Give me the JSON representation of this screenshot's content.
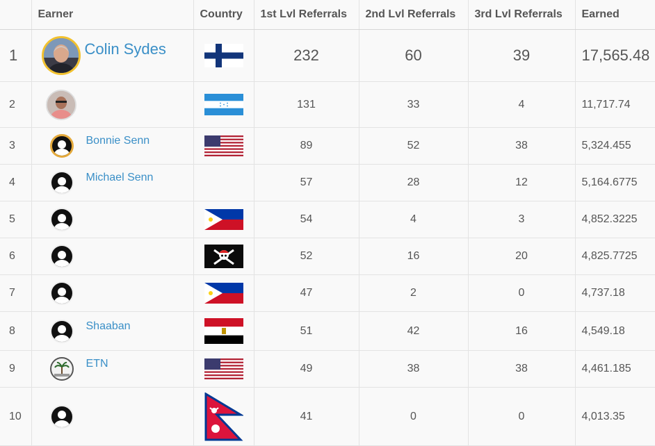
{
  "columns": {
    "rank": "",
    "earner": "Earner",
    "country": "Country",
    "lvl1": "1st Lvl Referrals",
    "lvl2": "2nd Lvl Referrals",
    "lvl3": "3rd Lvl Referrals",
    "earned": "Earned"
  },
  "rows": [
    {
      "rank": "1",
      "name": "Colin Sydes",
      "flag": "finland-flag",
      "lvl1": "232",
      "lvl2": "60",
      "lvl3": "39",
      "earned": "17,565.48"
    },
    {
      "rank": "2",
      "name": "",
      "flag": "honduras-flag",
      "lvl1": "131",
      "lvl2": "33",
      "lvl3": "4",
      "earned": "11,717.74"
    },
    {
      "rank": "3",
      "name": "Bonnie Senn",
      "flag": "usa-flag",
      "lvl1": "89",
      "lvl2": "52",
      "lvl3": "38",
      "earned": "5,324.455"
    },
    {
      "rank": "4",
      "name": "Michael Senn",
      "flag": "",
      "lvl1": "57",
      "lvl2": "28",
      "lvl3": "12",
      "earned": "5,164.6775"
    },
    {
      "rank": "5",
      "name": "",
      "flag": "philippines-flag",
      "lvl1": "54",
      "lvl2": "4",
      "lvl3": "3",
      "earned": "4,852.3225"
    },
    {
      "rank": "6",
      "name": "",
      "flag": "pirate-flag",
      "lvl1": "52",
      "lvl2": "16",
      "lvl3": "20",
      "earned": "4,825.7725"
    },
    {
      "rank": "7",
      "name": "",
      "flag": "philippines-flag",
      "lvl1": "47",
      "lvl2": "2",
      "lvl3": "0",
      "earned": "4,737.18"
    },
    {
      "rank": "8",
      "name": "Shaaban",
      "flag": "egypt-flag",
      "lvl1": "51",
      "lvl2": "42",
      "lvl3": "16",
      "earned": "4,549.18"
    },
    {
      "rank": "9",
      "name": "ETN",
      "flag": "usa-flag",
      "lvl1": "49",
      "lvl2": "38",
      "lvl3": "38",
      "earned": "4,461.185"
    },
    {
      "rank": "10",
      "name": "",
      "flag": "nepal-flag",
      "lvl1": "41",
      "lvl2": "0",
      "lvl3": "0",
      "earned": "4,013.35"
    }
  ],
  "colors": {
    "link": "#3a8fc7",
    "text": "#555555",
    "row_bg": "#f9f9f9",
    "grid": "#e3e3e3",
    "avatar_ring": "#e4a93b"
  }
}
